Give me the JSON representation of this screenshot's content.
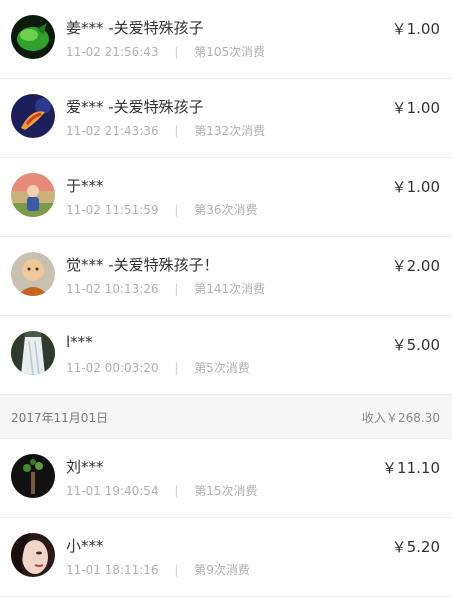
{
  "groups": [
    {
      "rows": [
        {
          "name": "姜*** -关爱特殊孩子",
          "time": "11-02 21:56:43",
          "count": "第105次消费",
          "amount": "￥1.00",
          "avatar": "green-leaf-avatar"
        },
        {
          "name": "爱*** -关爱特殊孩子",
          "time": "11-02 21:43:36",
          "count": "第132次消费",
          "amount": "￥1.00",
          "avatar": "koi-fish-avatar"
        },
        {
          "name": "于***",
          "time": "11-02 11:51:59",
          "count": "第36次消费",
          "amount": "￥1.00",
          "avatar": "person-garden-avatar"
        },
        {
          "name": "觉*** -关爱特殊孩子！",
          "time": "11-02 10:13:26",
          "count": "第141次消费",
          "amount": "￥2.00",
          "avatar": "monk-avatar"
        },
        {
          "name": "l***",
          "time": "11-02 00:03:20",
          "count": "第5次消费",
          "amount": "￥5.00",
          "avatar": "waterfall-avatar"
        }
      ]
    },
    {
      "date": "2017年11月01日",
      "income": "收入￥268.30",
      "rows": [
        {
          "name": "刘***",
          "time": "11-01 19:40:54",
          "count": "第15次消费",
          "amount": "￥11.10",
          "avatar": "tree-avatar"
        },
        {
          "name": "小***",
          "time": "11-01 18:11:16",
          "count": "第9次消费",
          "amount": "￥5.20",
          "avatar": "woman-face-avatar"
        }
      ]
    }
  ],
  "separator": "|"
}
